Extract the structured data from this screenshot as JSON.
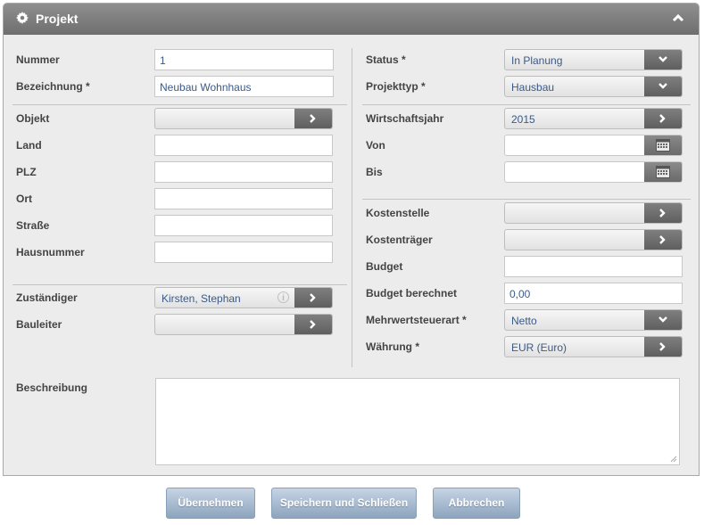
{
  "panel": {
    "title": "Projekt",
    "icon": "gear-icon"
  },
  "left": {
    "nummer": {
      "label": "Nummer",
      "value": "1"
    },
    "bezeichnung": {
      "label": "Bezeichnung *",
      "value": "Neubau Wohnhaus"
    },
    "objekt": {
      "label": "Objekt",
      "value": ""
    },
    "land": {
      "label": "Land",
      "value": ""
    },
    "plz": {
      "label": "PLZ",
      "value": ""
    },
    "ort": {
      "label": "Ort",
      "value": ""
    },
    "strasse": {
      "label": "Straße",
      "value": ""
    },
    "hausnummer": {
      "label": "Hausnummer",
      "value": ""
    },
    "zustaendiger": {
      "label": "Zuständiger",
      "value": "Kirsten, Stephan"
    },
    "bauleiter": {
      "label": "Bauleiter",
      "value": ""
    }
  },
  "right": {
    "status": {
      "label": "Status *",
      "value": "In Planung"
    },
    "projekttyp": {
      "label": "Projekttyp *",
      "value": "Hausbau"
    },
    "wirtschaftsjahr": {
      "label": "Wirtschaftsjahr",
      "value": "2015"
    },
    "von": {
      "label": "Von",
      "value": ""
    },
    "bis": {
      "label": "Bis",
      "value": ""
    },
    "kostenstelle": {
      "label": "Kostenstelle",
      "value": ""
    },
    "kostentraeger": {
      "label": "Kostenträger",
      "value": ""
    },
    "budget": {
      "label": "Budget",
      "value": ""
    },
    "budget_berechnet": {
      "label": "Budget berechnet",
      "value": "0,00"
    },
    "mwst": {
      "label": "Mehrwertsteuerart *",
      "value": "Netto"
    },
    "waehrung": {
      "label": "Währung *",
      "value": "EUR (Euro)"
    }
  },
  "beschreibung": {
    "label": "Beschreibung",
    "value": ""
  },
  "buttons": {
    "apply": "Übernehmen",
    "save_close": "Speichern und Schließen",
    "cancel": "Abbrechen"
  }
}
